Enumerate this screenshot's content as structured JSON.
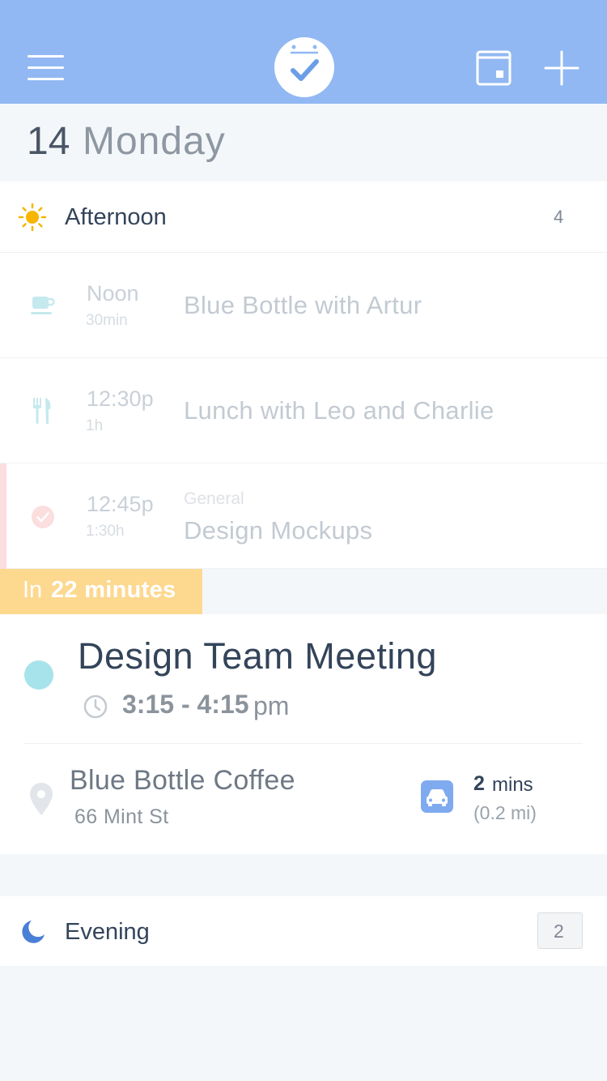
{
  "date": {
    "day_number": "14",
    "day_name": "Monday"
  },
  "colors": {
    "header": "#91b8f2",
    "event_dot": "#a6e3ea",
    "in_badge": "#fdd88f",
    "accent_red": "#fbdede",
    "car": "#80aaf0",
    "sun": "#f7b500",
    "moon": "#4a7fd6"
  },
  "icons": {
    "menu": "hamburger-icon",
    "logo": "calendar-check-icon",
    "today": "today-icon",
    "add": "plus-icon"
  },
  "afternoon": {
    "label": "Afternoon",
    "count": "4",
    "items": [
      {
        "time": "Noon",
        "duration": "30min",
        "title": "Blue Bottle with Artur",
        "icon": "coffee-icon"
      },
      {
        "time": "12:30p",
        "duration": "1h",
        "title": "Lunch with Leo and Charlie",
        "icon": "fork-knife-icon"
      },
      {
        "time": "12:45p",
        "duration": "1:30h",
        "category": "General",
        "title": "Design Mockups",
        "icon": "check-circle-icon"
      }
    ]
  },
  "upcoming": {
    "prefix": "In",
    "countdown": "22 minutes",
    "title": "Design Team Meeting",
    "time_range": "3:15 - 4:15",
    "time_suffix": "pm",
    "location_name": "Blue Bottle Coffee",
    "location_address": "66 Mint St",
    "travel_time_value": "2",
    "travel_time_unit": "mins",
    "travel_distance": "(0.2 mi)"
  },
  "evening": {
    "label": "Evening",
    "count": "2"
  }
}
